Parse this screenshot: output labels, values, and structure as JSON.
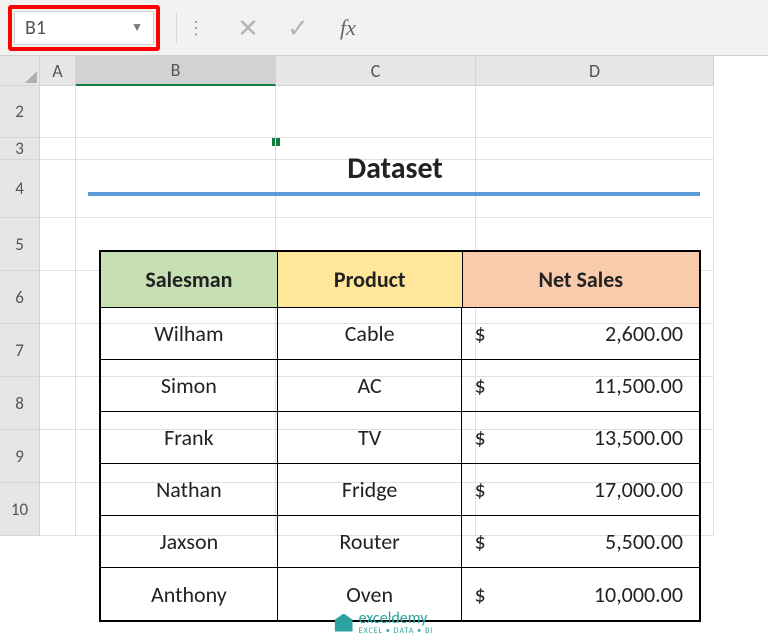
{
  "formula_bar": {
    "name_box_value": "B1",
    "fx_label": "fx"
  },
  "columns": {
    "A": "A",
    "B": "B",
    "C": "C",
    "D": "D"
  },
  "row_labels": [
    "2",
    "3",
    "4",
    "5",
    "6",
    "7",
    "8",
    "9",
    "10"
  ],
  "title": "Dataset",
  "table": {
    "headers": {
      "salesman": "Salesman",
      "product": "Product",
      "netsales": "Net Sales"
    },
    "rows": [
      {
        "salesman": "Wilham",
        "product": "Cable",
        "currency": "$",
        "netsales": "2,600.00"
      },
      {
        "salesman": "Simon",
        "product": "AC",
        "currency": "$",
        "netsales": "11,500.00"
      },
      {
        "salesman": "Frank",
        "product": "TV",
        "currency": "$",
        "netsales": "13,500.00"
      },
      {
        "salesman": "Nathan",
        "product": "Fridge",
        "currency": "$",
        "netsales": "17,000.00"
      },
      {
        "salesman": "Jaxson",
        "product": "Router",
        "currency": "$",
        "netsales": "5,500.00"
      },
      {
        "salesman": "Anthony",
        "product": "Oven",
        "currency": "$",
        "netsales": "10,000.00"
      }
    ]
  },
  "watermark": {
    "brand": "exceldemy",
    "tagline": "EXCEL • DATA • BI"
  }
}
